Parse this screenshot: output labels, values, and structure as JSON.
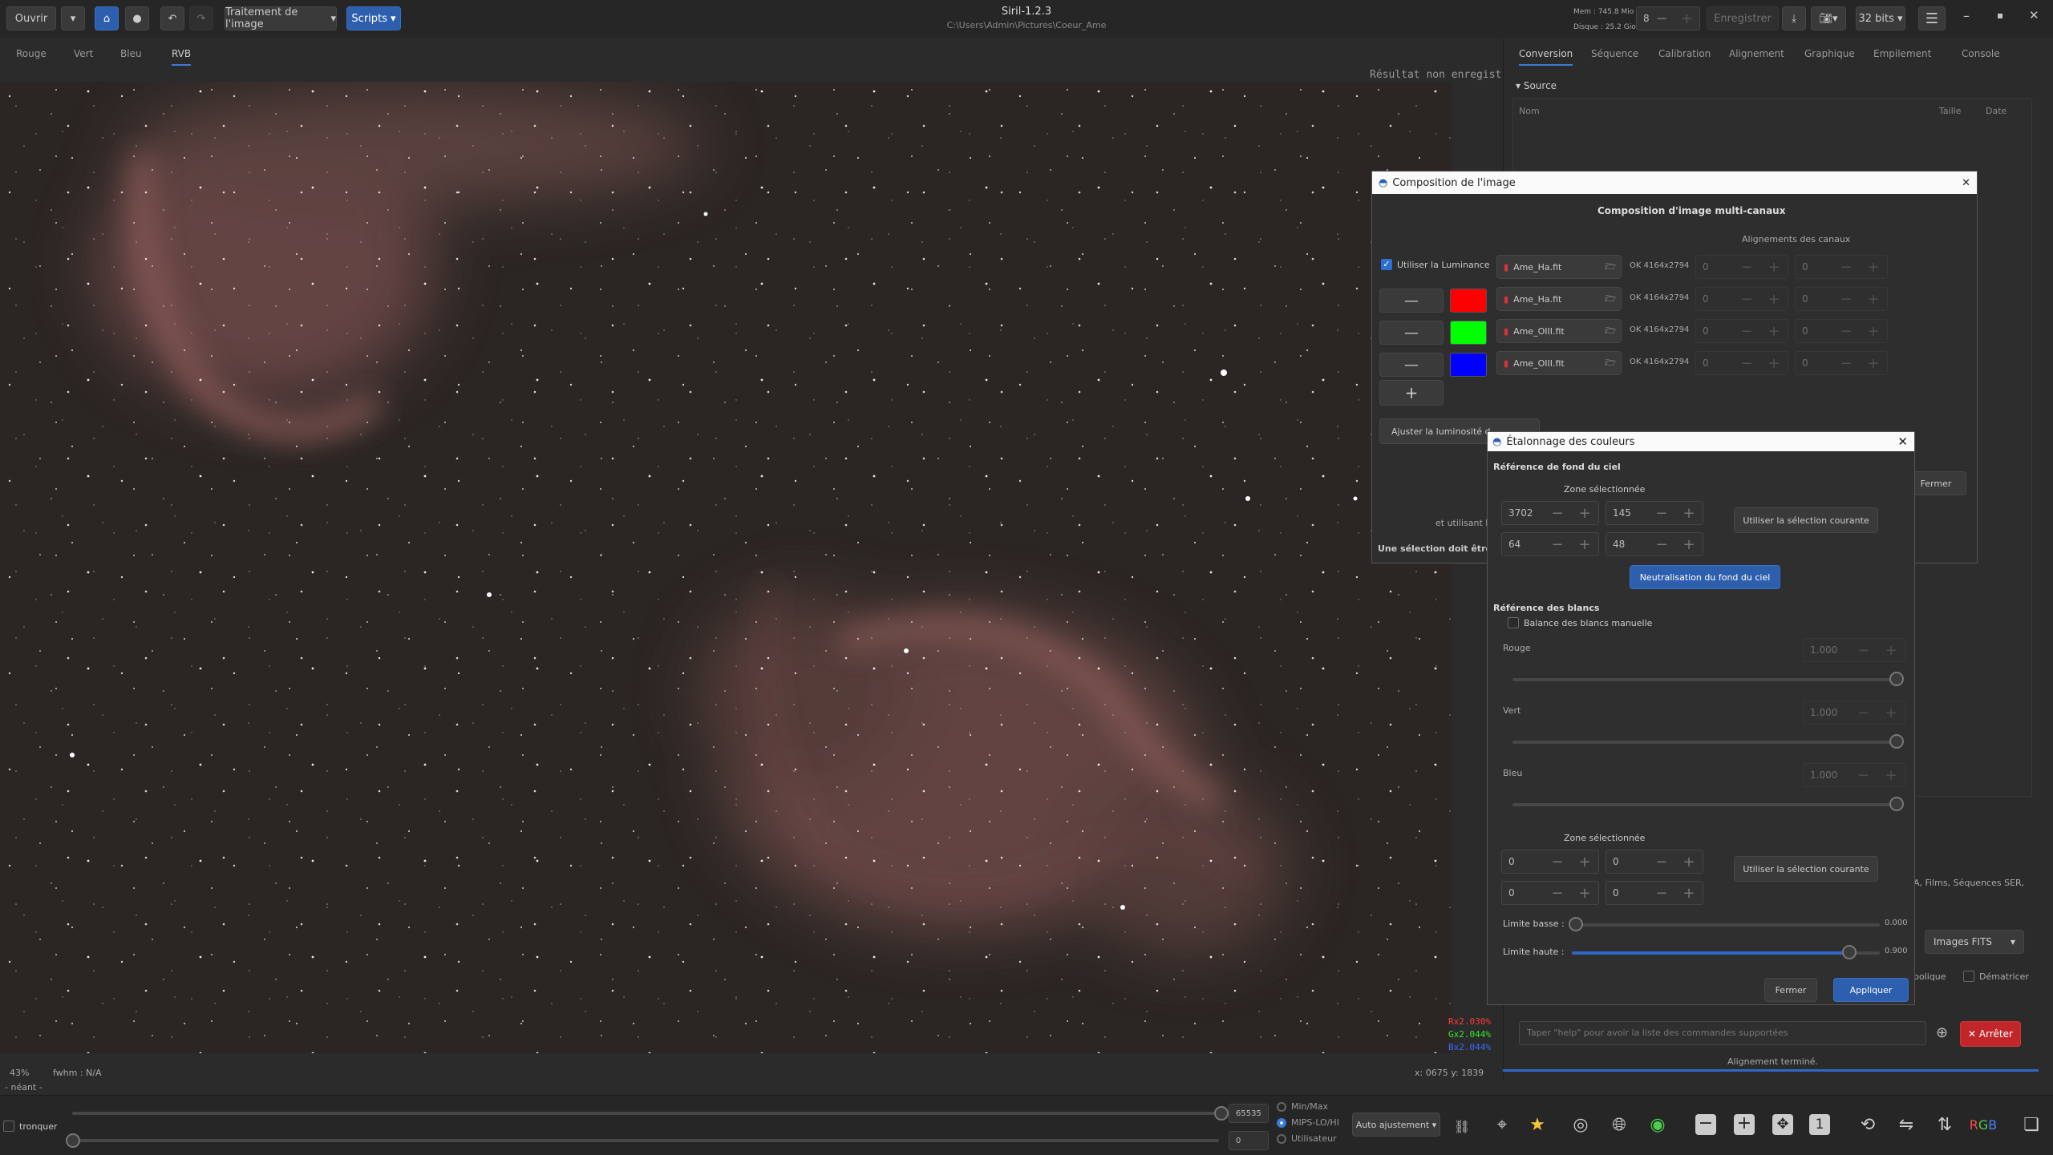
{
  "toolbar": {
    "open_label": "Ouvrir",
    "image_processing_label": "Traitement de l'image",
    "scripts_label": "Scripts",
    "app_title": "Siril-1.2.3",
    "app_path": "C:\\Users\\Admin\\Pictures\\Coeur_Ame",
    "mem_label": "Mem : 745.8 Mio",
    "disk_label": "Disque : 25.2 Gio",
    "threads_value": "8",
    "save_label": "Enregistrer",
    "bits_label": "32 bits"
  },
  "channel_tabs": [
    "Rouge",
    "Vert",
    "Bleu",
    "RVB"
  ],
  "image_panel": {
    "unsaved_label": "Résultat non enregistré",
    "zoom_label": "43%",
    "fwhm_label": "fwhm  :  N/A",
    "coords_label": "x: 0675  y: 1839",
    "neant_label": "- néant -",
    "stats": {
      "r": "Rx2.030%",
      "g": "Gx2.044%",
      "b": "Bx2.044%"
    }
  },
  "right_tabs": [
    "Conversion",
    "Séquence",
    "Calibration",
    "Alignement",
    "Graphique",
    "Empilement",
    "Console"
  ],
  "conversion_panel": {
    "source_label": "Source",
    "columns": [
      "Nom",
      "Taille",
      "Date"
    ],
    "formats_text": "A, Films, Séquences SER,",
    "format_select": "Images FITS",
    "symbolic_label": "bolique",
    "debayer_label": "Dématricer",
    "command_placeholder": "Taper \"help\" pour avoir la liste des commandes supportées",
    "stop_label": "Arrêter",
    "status_text": "Alignement terminé."
  },
  "composition": {
    "title": "Composition de l'image",
    "heading": "Composition d'image multi-canaux",
    "align_heading": "Alignements des canaux",
    "use_luminance_label": "Utiliser la Luminance",
    "rows": [
      {
        "file": "Ame_Ha.fit",
        "status": "OK 4164x2794",
        "x": "0",
        "y": "0",
        "color": ""
      },
      {
        "file": "Ame_Ha.fit",
        "status": "OK 4164x2794",
        "x": "0",
        "y": "0",
        "color": "#ff0000"
      },
      {
        "file": "Ame_OIII.fit",
        "status": "OK 4164x2794",
        "x": "0",
        "y": "0",
        "color": "#00ff00"
      },
      {
        "file": "Ame_OIII.fit",
        "status": "OK 4164x2794",
        "x": "0",
        "y": "0",
        "color": "#0000ff"
      }
    ],
    "adjust_label": "Ajuster la luminosité d",
    "close_label": "Fermer",
    "using_text": "et utilisant la m",
    "selection_text": "Une sélection doit être fa"
  },
  "calibration": {
    "title": "Étalonnage des couleurs",
    "bg_heading": "Référence de fond du ciel",
    "zone_label": "Zone sélectionnée",
    "bg_values": [
      "3702",
      "145",
      "64",
      "48"
    ],
    "use_selection_label": "Utiliser la sélection courante",
    "neutralize_label": "Neutralisation du fond du ciel",
    "white_heading": "Référence des blancs",
    "manual_wb_label": "Balance des blancs manuelle",
    "channels": [
      {
        "label": "Rouge",
        "value": "1.000"
      },
      {
        "label": "Vert",
        "value": "1.000"
      },
      {
        "label": "Bleu",
        "value": "1.000"
      }
    ],
    "zone2_label": "Zone sélectionnée",
    "white_values": [
      "0",
      "0",
      "0",
      "0"
    ],
    "low_label": "Limite basse :",
    "low_value": "0.000",
    "high_label": "Limite haute :",
    "high_value": "0.900",
    "low_fraction": 0.0,
    "high_fraction": 0.9,
    "close_label": "Fermer",
    "apply_label": "Appliquer"
  },
  "bottom": {
    "crop_label": "tronquer",
    "max_value": "65535",
    "min_value": "0",
    "radio_options": [
      "Min/Max",
      "MIPS-LO/HI",
      "Utilisateur"
    ],
    "auto_label": "Auto ajustement"
  }
}
